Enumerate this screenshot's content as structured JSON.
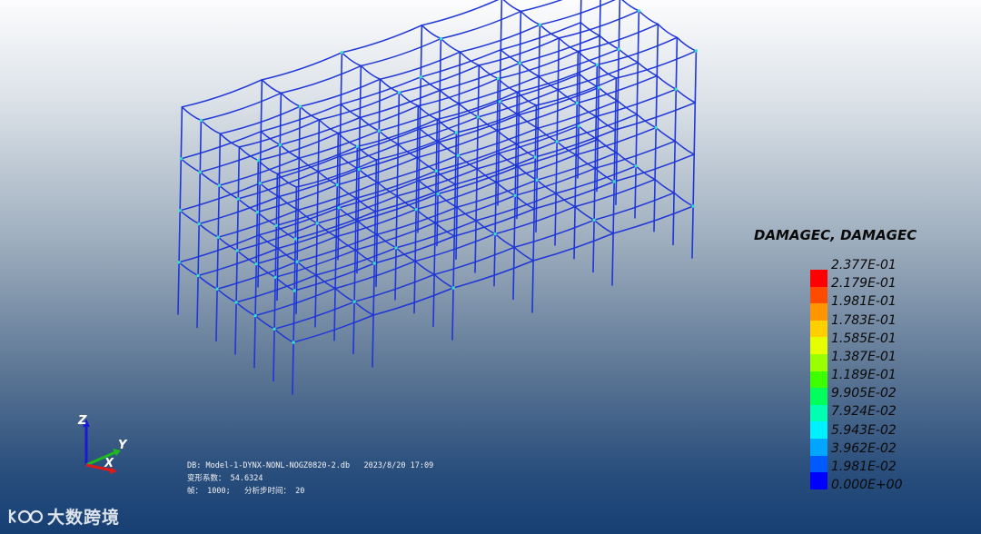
{
  "legend": {
    "title": "DAMAGEC, DAMAGEC",
    "ticks": [
      "2.377E-01",
      "2.179E-01",
      "1.981E-01",
      "1.783E-01",
      "1.585E-01",
      "1.387E-01",
      "1.189E-01",
      "9.905E-02",
      "7.924E-02",
      "5.943E-02",
      "3.962E-02",
      "1.981E-02",
      "0.000E+00"
    ],
    "colors": [
      "#ff0000",
      "#ff4b00",
      "#ff9500",
      "#ffcf00",
      "#e5ff00",
      "#9aff00",
      "#3cff00",
      "#00ff5a",
      "#00ffb0",
      "#00f0ff",
      "#00a6ff",
      "#005aff",
      "#0000ff"
    ]
  },
  "axes_triad": {
    "z_label": "Z",
    "y_label": "Y",
    "x_label": "X",
    "z_color": "#1a1ad6",
    "y_color": "#1fb81f",
    "x_color": "#e01a1a"
  },
  "info": {
    "db_line": "DB: Model-1-DYNX-NONL-NOGZ0820-2.db   2023/8/20 17:09",
    "scale_line": "变形系数： 54.6324",
    "frame_line": "帧： 1000;   分析步时间： 20"
  },
  "watermark": {
    "text": "大数跨境"
  },
  "model": {
    "frame_color": "#1f36d8",
    "hot_color": "#35e0c8"
  }
}
